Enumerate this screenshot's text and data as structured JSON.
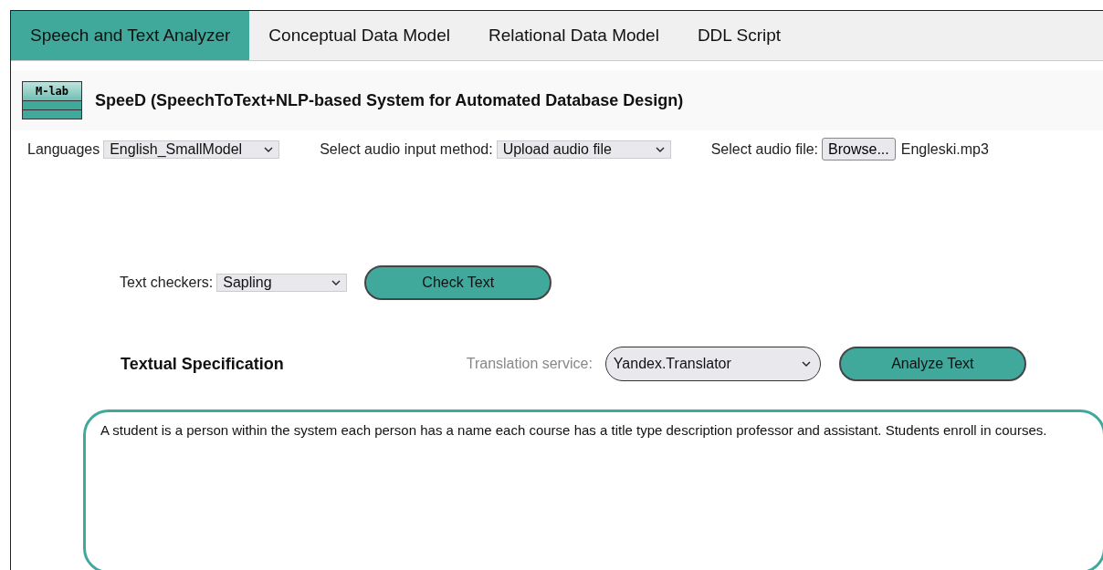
{
  "tabs": [
    {
      "label": "Speech and Text Analyzer",
      "selected": true
    },
    {
      "label": "Conceptual Data Model",
      "selected": false
    },
    {
      "label": "Relational Data Model",
      "selected": false
    },
    {
      "label": "DDL Script",
      "selected": false
    }
  ],
  "header": {
    "logo_text": "M-lab",
    "title": "SpeeD (SpeechToText+NLP-based System for Automated Database Design)"
  },
  "input_row": {
    "languages_label": "Languages",
    "languages_value": "English_SmallModel",
    "method_label": "Select audio input method:",
    "method_value": "Upload audio file",
    "file_label": "Select audio file:",
    "browse_button": "Browse...",
    "file_name": "Engleski.mp3"
  },
  "checker_row": {
    "label": "Text checkers:",
    "value": "Sapling",
    "button": "Check Text"
  },
  "spec_row": {
    "title": "Textual Specification",
    "translation_label": "Translation service:",
    "translation_value": "Yandex.Translator",
    "button": "Analyze Text"
  },
  "specification_text": "A student is a person within the system each person has a name each course has a title type description professor and assistant. Students enroll in courses."
}
